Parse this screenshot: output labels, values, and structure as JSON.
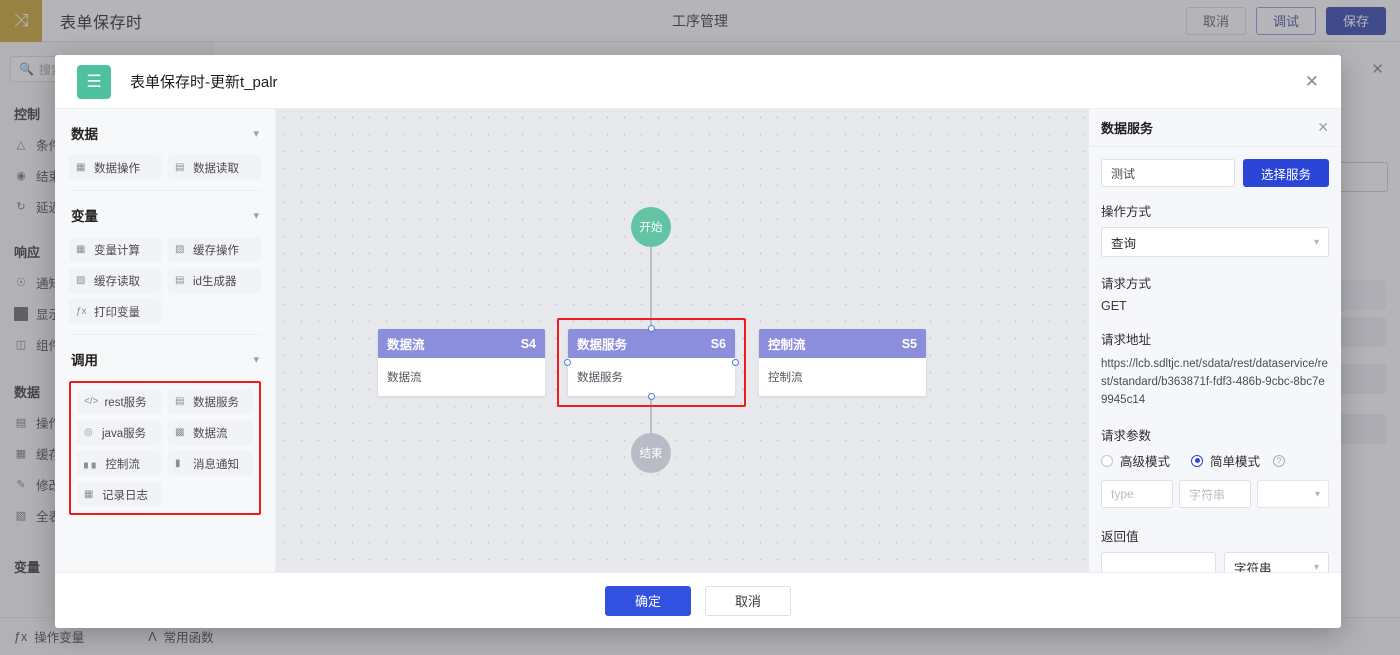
{
  "topbar": {
    "logo_icon": "shuffle-icon",
    "title": "表单保存时",
    "page_title": "工序管理",
    "cancel_label": "取消",
    "debug_label": "调试",
    "save_label": "保存"
  },
  "sidebar": {
    "search_placeholder": "搜索",
    "groups": [
      {
        "title": "控制",
        "items": [
          {
            "label": "条件分",
            "icon": "branch-icon"
          },
          {
            "label": "结束",
            "icon": "target-icon"
          },
          {
            "label": "延迟执",
            "icon": "loop-icon"
          }
        ]
      },
      {
        "title": "响应",
        "items": [
          {
            "label": "通知提",
            "icon": "bell-icon"
          },
          {
            "label": "显示蒙",
            "icon": "square-icon"
          },
          {
            "label": "组件动",
            "icon": "component-icon"
          }
        ]
      },
      {
        "title": "数据",
        "items": [
          {
            "label": "操作资",
            "icon": "data-read-icon"
          },
          {
            "label": "缓存读",
            "icon": "cache-read-icon"
          },
          {
            "label": "修改数",
            "icon": "pencil-icon"
          },
          {
            "label": "全表设",
            "icon": "table-icon"
          }
        ]
      },
      {
        "title": "变量",
        "items": []
      }
    ],
    "bottom_items": [
      {
        "label": "操作变量",
        "icon": "fx-icon"
      },
      {
        "label": "常用函数",
        "icon": "function-icon"
      }
    ]
  },
  "modal": {
    "icon": "flow-node-icon",
    "title": "表单保存时-更新t_palr",
    "close_icon": "close-icon",
    "footer": {
      "confirm_label": "确定",
      "cancel_label": "取消"
    },
    "palette": {
      "sections": [
        {
          "title": "数据",
          "chevron": "chevron-down-icon",
          "highlighted": false,
          "items": [
            {
              "label": "数据操作",
              "icon": "data-op-icon"
            },
            {
              "label": "数据读取",
              "icon": "data-read-icon"
            }
          ]
        },
        {
          "title": "变量",
          "chevron": "chevron-down-icon",
          "highlighted": false,
          "items": [
            {
              "label": "变量计算",
              "icon": "calc-icon"
            },
            {
              "label": "缓存操作",
              "icon": "cache-op-icon"
            },
            {
              "label": "缓存读取",
              "icon": "cache-read-icon"
            },
            {
              "label": "id生成器",
              "icon": "id-gen-icon"
            },
            {
              "label": "打印变量",
              "icon": "fx-icon"
            }
          ]
        },
        {
          "title": "调用",
          "chevron": "chevron-down-icon",
          "highlighted": true,
          "highlight_color": "#ee1c1c",
          "items": [
            {
              "label": "rest服务",
              "icon": "code-icon"
            },
            {
              "label": "数据服务",
              "icon": "service-icon"
            },
            {
              "label": "java服务",
              "icon": "java-icon"
            },
            {
              "label": "数据流",
              "icon": "dataflow-icon"
            },
            {
              "label": "控制流",
              "icon": "controlflow-icon"
            },
            {
              "label": "消息通知",
              "icon": "message-icon"
            },
            {
              "label": "记录日志",
              "icon": "log-icon"
            }
          ]
        }
      ]
    },
    "canvas": {
      "start_node": {
        "label": "开始",
        "color": "#62c4a5"
      },
      "end_node": {
        "label": "结束",
        "color": "#b9bcc7"
      },
      "header_color": "#8b8fdb",
      "selection_color": "#ee1c1c",
      "nodes": [
        {
          "title": "数据流",
          "code": "S4",
          "body": "数据流",
          "selected": false
        },
        {
          "title": "数据服务",
          "code": "S6",
          "body": "数据服务",
          "selected": true
        },
        {
          "title": "控制流",
          "code": "S5",
          "body": "控制流",
          "selected": false
        }
      ]
    },
    "props": {
      "title": "数据服务",
      "close_icon": "close-icon",
      "service_name": "测试",
      "select_service_label": "选择服务",
      "operation_label": "操作方式",
      "operation_value": "查询",
      "method_label": "请求方式",
      "method_value": "GET",
      "url_label": "请求地址",
      "url_value": "https://lcb.sdltjc.net/sdata/rest/dataservice/rest/standard/b363871f-fdf3-486b-9cbc-8bc7e9945c14",
      "params_label": "请求参数",
      "mode_advanced_label": "高级模式",
      "mode_simple_label": "简单模式",
      "mode_selected": "简单模式",
      "help_icon": "question-icon",
      "param_name_placeholder": "type",
      "param_type_placeholder": "字符串",
      "param_extra_placeholder": "",
      "return_label": "返回值",
      "return_name_placeholder": "",
      "return_type_value": "字符串",
      "accent_color": "#2b46d6"
    }
  },
  "background": {
    "panel_close_icon": "close-icon"
  }
}
